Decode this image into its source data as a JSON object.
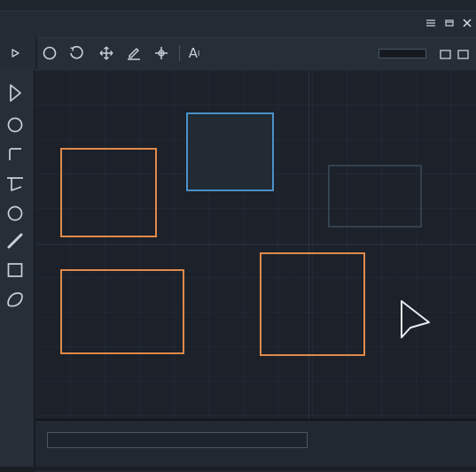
{
  "window": {
    "controls": [
      {
        "icon": "menu-icon"
      },
      {
        "icon": "restore-icon"
      },
      {
        "icon": "close-icon"
      }
    ]
  },
  "toolbar": {
    "tools": [
      {
        "icon": "play-icon"
      },
      {
        "icon": "circle-icon"
      },
      {
        "icon": "rotate-icon"
      },
      {
        "icon": "move-icon"
      },
      {
        "icon": "pen-icon"
      },
      {
        "icon": "crosshair-icon"
      },
      {
        "icon": "text-icon",
        "label": "A",
        "superscript": "I"
      }
    ],
    "zoom_value": "",
    "view_toggles": [
      {
        "icon": "square-view-icon"
      },
      {
        "icon": "square-view-icon"
      }
    ]
  },
  "sidebar": {
    "tools": [
      {
        "icon": "pointer-icon"
      },
      {
        "icon": "circle-icon"
      },
      {
        "icon": "corner-icon"
      },
      {
        "icon": "path-icon"
      },
      {
        "icon": "circle-icon"
      },
      {
        "icon": "pencil-icon"
      },
      {
        "icon": "rectangle-icon"
      },
      {
        "icon": "lasso-icon"
      }
    ]
  },
  "canvas": {
    "shapes": [
      {
        "type": "rectangle",
        "stroke": "#e08a4a",
        "state": "normal"
      },
      {
        "type": "rectangle",
        "stroke": "#4a90c9",
        "state": "selected"
      },
      {
        "type": "rectangle",
        "stroke": "#34414f",
        "state": "faded"
      },
      {
        "type": "rectangle",
        "stroke": "#e08a4a",
        "state": "normal"
      },
      {
        "type": "rectangle",
        "stroke": "#e08a4a",
        "state": "normal"
      }
    ],
    "cursor": "arrow-cursor"
  },
  "statusbar": {
    "value": ""
  },
  "colors": {
    "background": "#1c2128",
    "panel": "#262e38",
    "accent_orange": "#e08a4a",
    "accent_blue": "#4a90c9",
    "icon": "#c8d0da"
  }
}
